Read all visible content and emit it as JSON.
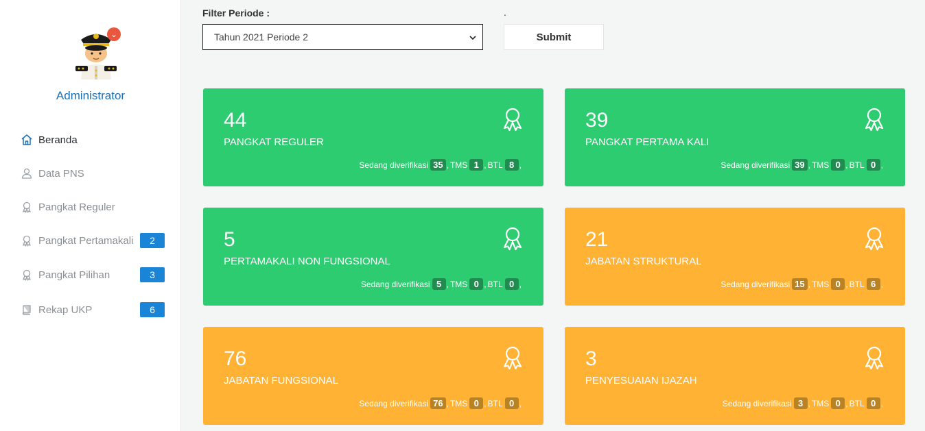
{
  "user": {
    "name": "Administrator"
  },
  "nav": [
    {
      "label": "Beranda",
      "icon": "home-icon",
      "badge": ""
    },
    {
      "label": "Data PNS",
      "icon": "user-icon",
      "badge": ""
    },
    {
      "label": "Pangkat Reguler",
      "icon": "award-icon",
      "badge": ""
    },
    {
      "label": "Pangkat Pertamakali",
      "icon": "award-icon",
      "badge": "2"
    },
    {
      "label": "Pangkat Pilihan",
      "icon": "award-icon",
      "badge": "3"
    },
    {
      "label": "Rekap UKP",
      "icon": "book-icon",
      "badge": "6"
    }
  ],
  "filter": {
    "label": "Filter Periode :",
    "aux_label": ".",
    "selected": "Tahun 2021 Periode 2",
    "submit_label": "Submit"
  },
  "meta_labels": {
    "verifying": "Sedang diverifikasi",
    "tms": "TMS",
    "btl": "BTL",
    "sep": ",",
    "trail": ","
  },
  "cards": [
    {
      "count": "44",
      "title": "PANGKAT REGULER",
      "verifying": "35",
      "tms": "1",
      "btl": "8",
      "color": "#2ecc71"
    },
    {
      "count": "39",
      "title": "PANGKAT PERTAMA KALI",
      "verifying": "39",
      "tms": "0",
      "btl": "0",
      "color": "#2ecc71"
    },
    {
      "count": "5",
      "title": "PERTAMAKALI NON FUNGSIONAL",
      "verifying": "5",
      "tms": "0",
      "btl": "0",
      "color": "#2ecc71"
    },
    {
      "count": "21",
      "title": "JABATAN STRUKTURAL",
      "verifying": "15",
      "tms": "0",
      "btl": "6",
      "color": "#ffb234"
    },
    {
      "count": "76",
      "title": "JABATAN FUNGSIONAL",
      "verifying": "76",
      "tms": "0",
      "btl": "0",
      "color": "#ffb234"
    },
    {
      "count": "3",
      "title": "PENYESUAIAN IJAZAH",
      "verifying": "3",
      "tms": "0",
      "btl": "0",
      "color": "#ffb234"
    }
  ]
}
